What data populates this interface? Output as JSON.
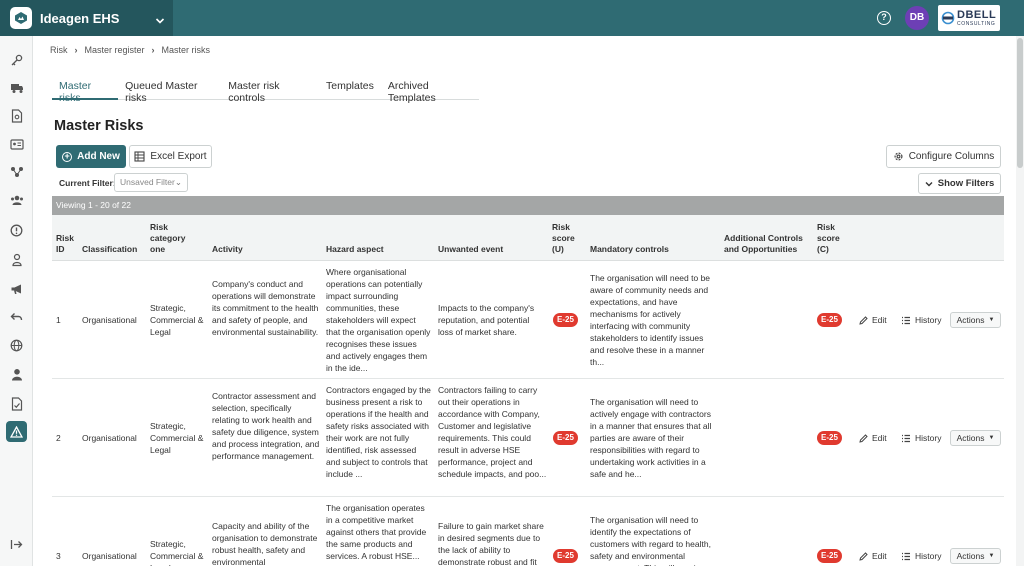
{
  "app": {
    "name": "Ideagen EHS"
  },
  "header": {
    "help_icon": "question-circle-icon",
    "avatar_initials": "DB",
    "company_logo": {
      "main": "DBELL",
      "sub": "CONSULTING"
    }
  },
  "sidebar": {
    "items": [
      "key-icon",
      "truck-icon",
      "document-search-icon",
      "id-card-icon",
      "network-icon",
      "people-icon",
      "alert-circle-icon",
      "person-badge-icon",
      "megaphone-icon",
      "undo-arrow-icon",
      "globe-icon",
      "user-icon",
      "document-check-icon",
      "warning-triangle-icon"
    ],
    "active_item": "warning-triangle-icon",
    "collapse_icon": "collapse-arrow-icon"
  },
  "breadcrumb": [
    "Risk",
    "Master register",
    "Master risks"
  ],
  "tabs": [
    {
      "label": "Master risks",
      "active": true
    },
    {
      "label": "Queued Master risks",
      "active": false
    },
    {
      "label": "Master risk controls",
      "active": false
    },
    {
      "label": "Templates",
      "active": false
    },
    {
      "label": "Archived Templates",
      "active": false
    }
  ],
  "page": {
    "title": "Master Risks"
  },
  "toolbar": {
    "add_new": "Add New",
    "excel_export": "Excel Export",
    "configure_columns": "Configure Columns",
    "show_filters": "Show Filters",
    "current_filter_label": "Current Filter:",
    "current_filter_value": "Unsaved Filter"
  },
  "viewing": "Viewing 1 - 20 of 22",
  "columns": {
    "risk_id": "Risk ID",
    "classification": "Classification",
    "category": "Risk category one",
    "activity": "Activity",
    "hazard": "Hazard aspect",
    "unwanted": "Unwanted event",
    "score_u": "Risk score (U)",
    "mandatory": "Mandatory controls",
    "additional": "Additional Controls and Opportunities",
    "score_c": "Risk score (C)"
  },
  "row_actions": {
    "edit": "Edit",
    "history": "History",
    "actions": "Actions"
  },
  "rows": [
    {
      "id": "1",
      "classification": "Organisational",
      "category": "Strategic, Commercial & Legal",
      "activity": "Company's conduct and operations will demonstrate its commitment to the health and safety of people, and environmental sustainability.",
      "hazard": "Where organisational operations can potentially impact surrounding communities, these stakeholders will expect that the organisation openly recognises these issues and actively engages them in the ide...",
      "unwanted": "Impacts to the company's reputation, and potential loss of market share.",
      "score_u": "E-25",
      "mandatory": "The organisation will need to be aware of community needs and expectations, and have mechanisms for actively interfacing with community stakeholders to identify issues and resolve these in a manner th...",
      "score_c": "E-25"
    },
    {
      "id": "2",
      "classification": "Organisational",
      "category": "Strategic, Commercial & Legal",
      "activity": "Contractor assessment and selection, specifically relating to work health and safety due diligence, system and process integration, and performance management.",
      "hazard": "Contractors engaged by the business present a risk to operations if the health and safety risks associated with their work are not fully identified, risk assessed and subject to controls that include ...",
      "unwanted": "Contractors failing to carry out their operations in accordance with Company, Customer and legislative requirements. This could result in adverse HSE performance, project and schedule impacts, and poo...",
      "score_u": "E-25",
      "mandatory": "The organisation will need to actively engage with contractors in a manner that ensures that all parties are aware of their responsibilities with regard to undertaking work activities in a safe and he...",
      "score_c": "E-25"
    },
    {
      "id": "3",
      "classification": "Organisational",
      "category": "Strategic, Commercial & Legal",
      "activity": "Capacity and ability of the organisation to demonstrate robust health, safety and environmental",
      "hazard": "The organisation operates in a competitive market against others that provide the same products and services. A robust HSE...",
      "unwanted": "Failure to gain market share in desired segments due to the lack of ability to demonstrate robust and fit",
      "score_u": "E-25",
      "mandatory": "The organisation will need to identify the expectations of customers with regard to health, safety and environmental management. This will require",
      "score_c": "E-25"
    }
  ]
}
